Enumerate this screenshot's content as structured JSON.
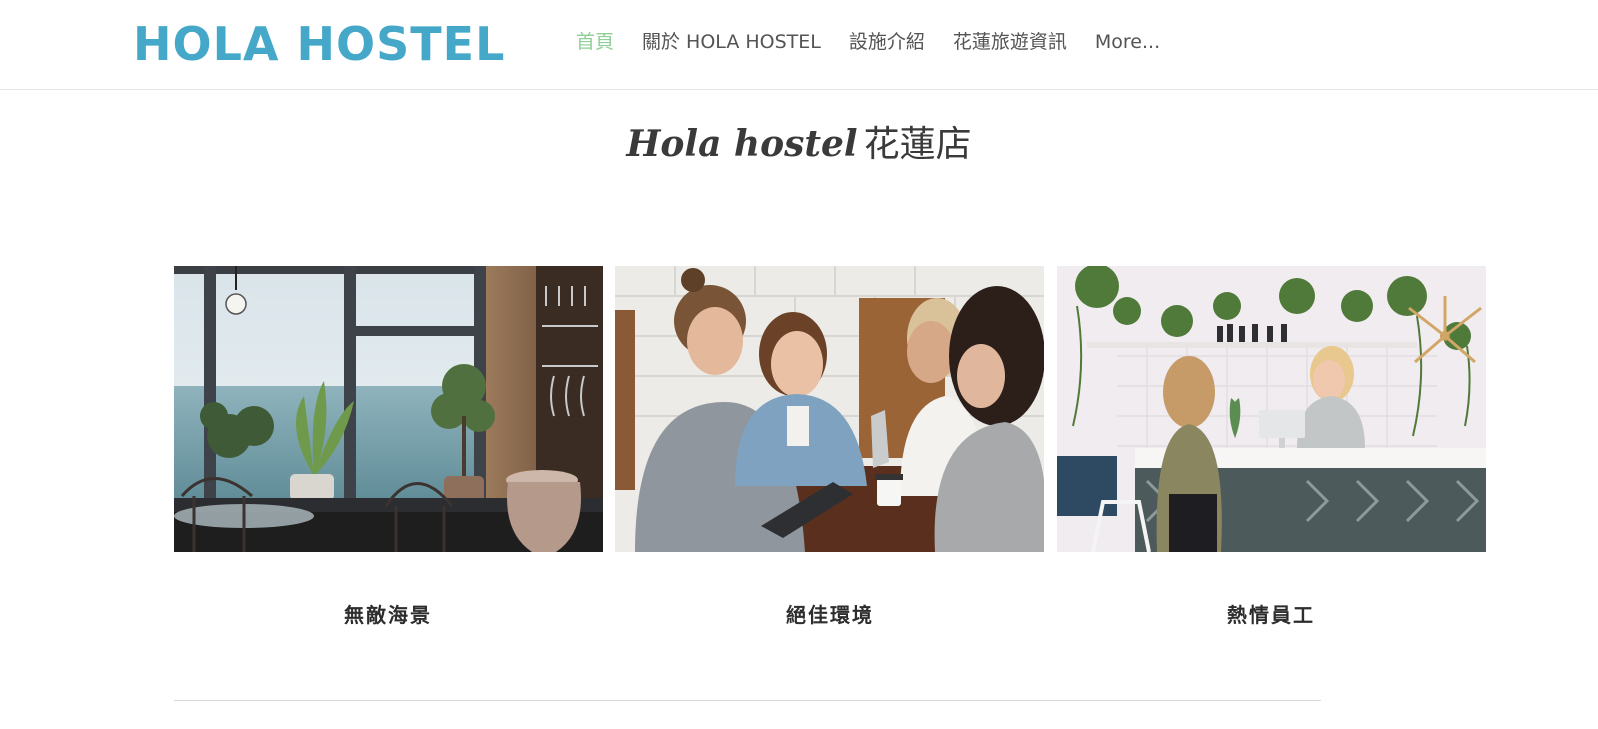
{
  "header": {
    "logo_text": "HOLA HOSTEL",
    "logo_color": "#46a8c9",
    "nav": [
      {
        "label": "首頁",
        "active": true
      },
      {
        "label": "關於 HOLA HOSTEL",
        "active": false
      },
      {
        "label": "設施介紹",
        "active": false
      },
      {
        "label": "花蓮旅遊資訊",
        "active": false
      },
      {
        "label": "More...",
        "active": false
      }
    ],
    "active_color": "#8fcf98"
  },
  "main": {
    "title_script": "Hola hostel",
    "title_cjk": "花蓮店",
    "features": [
      {
        "caption": "無敵海景",
        "photo": "sea-view-cafe-photo"
      },
      {
        "caption": "絕佳環境",
        "photo": "friends-at-table-photo"
      },
      {
        "caption": "熱情員工",
        "photo": "reception-desk-photo"
      }
    ]
  }
}
